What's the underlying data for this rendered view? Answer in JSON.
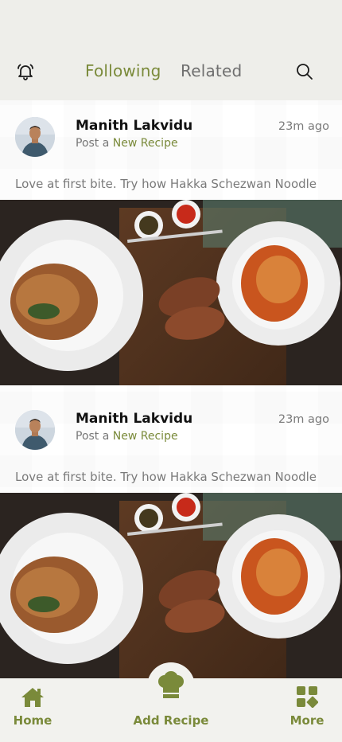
{
  "header": {
    "bell_icon": "bell-icon",
    "tabs": [
      {
        "label": "Following",
        "active": true
      },
      {
        "label": "Related",
        "active": false
      }
    ],
    "search_icon": "search-icon",
    "accent_color": "#7a8a3a"
  },
  "posts": [
    {
      "author": "Manith Lakvidu",
      "action_prefix": "Post a",
      "action_highlight": "New Recipe",
      "time": "23m ago",
      "caption": "Love at first bite. Try how Hakka Schezwan Noodle"
    },
    {
      "author": "Manith Lakvidu",
      "action_prefix": "Post a",
      "action_highlight": "New Recipe",
      "time": "23m ago",
      "caption": "Love at first bite. Try how Hakka Schezwan Noodle"
    }
  ],
  "bottom_nav": {
    "home": {
      "label": "Home",
      "icon": "home-icon"
    },
    "add": {
      "label": "Add Recipe",
      "icon": "chef-hat-icon"
    },
    "more": {
      "label": "More",
      "icon": "grid-icon"
    }
  }
}
